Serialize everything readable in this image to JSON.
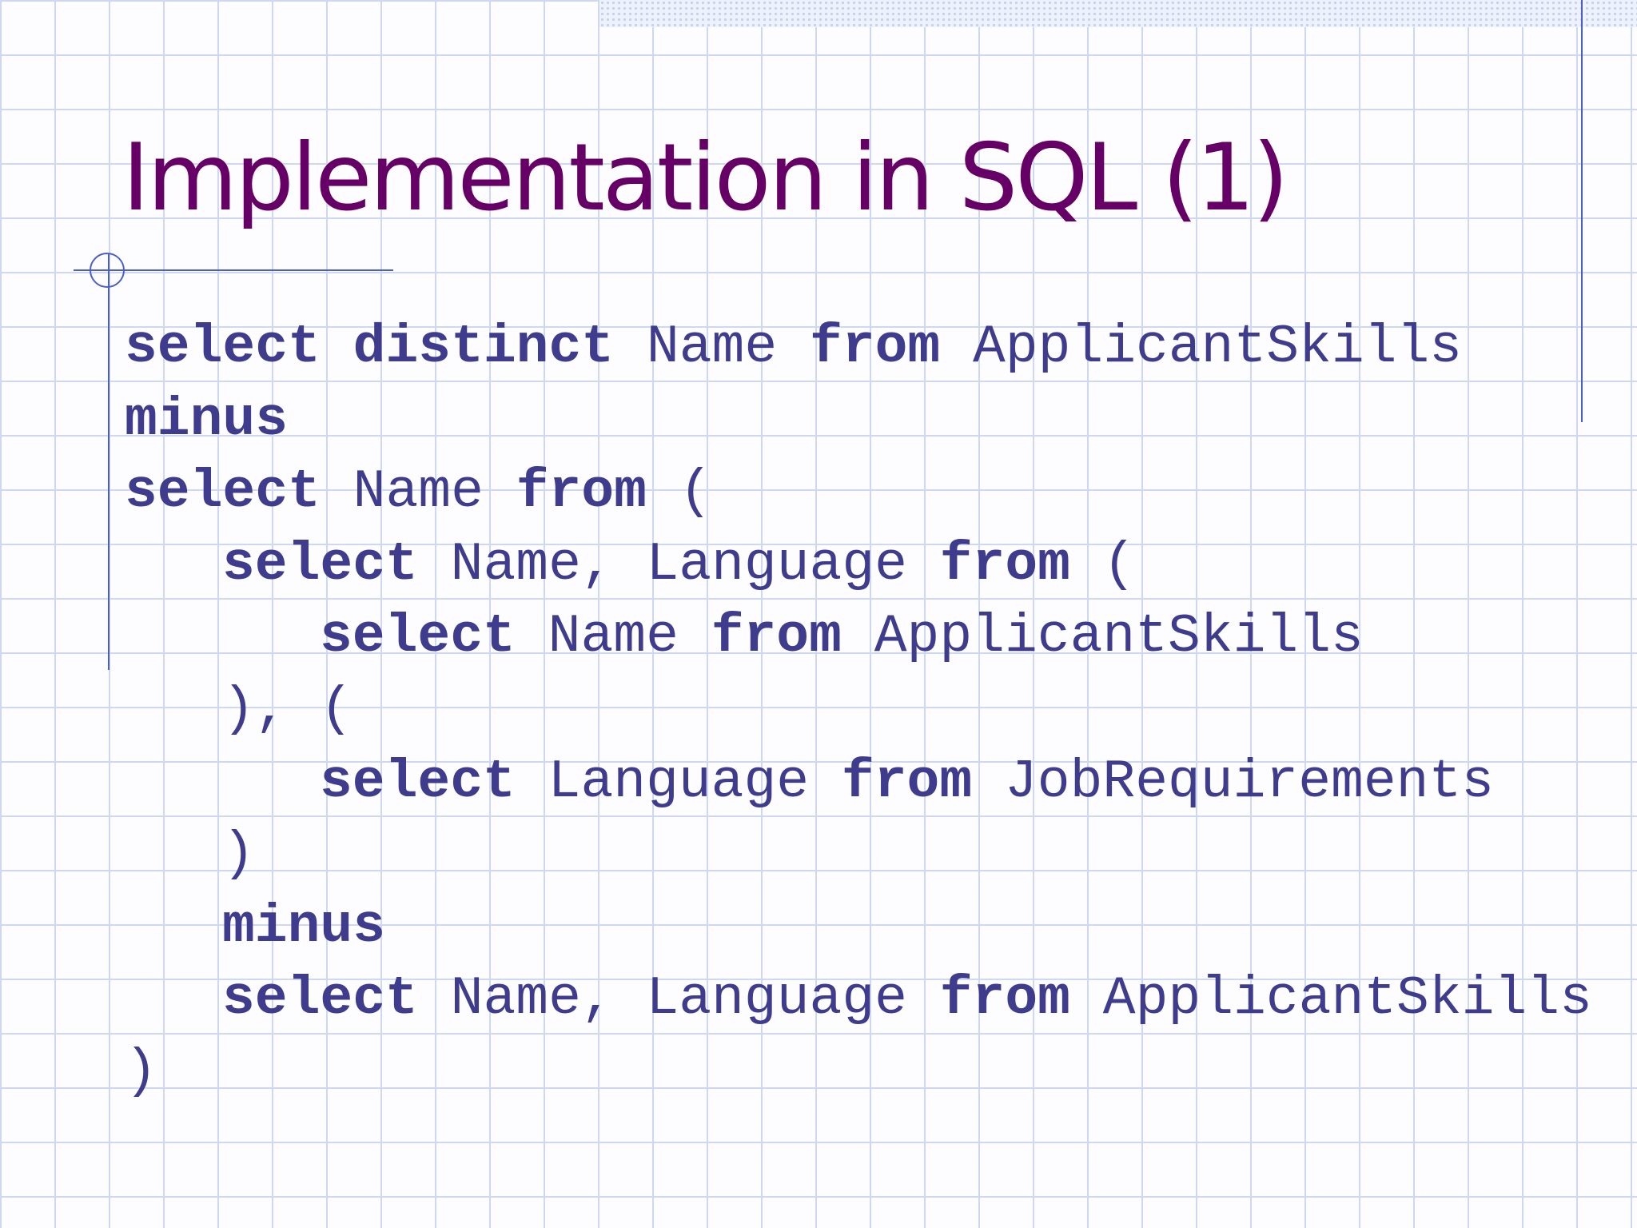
{
  "slide": {
    "title": "Implementation in SQL (1)"
  },
  "code": {
    "lines": [
      {
        "indent": 0,
        "tokens": [
          {
            "text": "select distinct",
            "kind": "keyword"
          },
          {
            "text": " Name ",
            "kind": "plain"
          },
          {
            "text": "from",
            "kind": "keyword"
          },
          {
            "text": " ApplicantSkills",
            "kind": "plain"
          }
        ]
      },
      {
        "indent": 0,
        "tokens": [
          {
            "text": "minus",
            "kind": "keyword"
          }
        ]
      },
      {
        "indent": 0,
        "tokens": [
          {
            "text": "select",
            "kind": "keyword"
          },
          {
            "text": " Name ",
            "kind": "plain"
          },
          {
            "text": "from",
            "kind": "keyword"
          },
          {
            "text": " (",
            "kind": "plain"
          }
        ]
      },
      {
        "indent": 1,
        "tokens": [
          {
            "text": "select",
            "kind": "keyword"
          },
          {
            "text": " Name, Language ",
            "kind": "plain"
          },
          {
            "text": "from",
            "kind": "keyword"
          },
          {
            "text": " (",
            "kind": "plain"
          }
        ]
      },
      {
        "indent": 2,
        "tokens": [
          {
            "text": "select",
            "kind": "keyword"
          },
          {
            "text": " Name ",
            "kind": "plain"
          },
          {
            "text": "from",
            "kind": "keyword"
          },
          {
            "text": " ApplicantSkills",
            "kind": "plain"
          }
        ]
      },
      {
        "indent": 1,
        "tokens": [
          {
            "text": "), (",
            "kind": "plain"
          }
        ]
      },
      {
        "indent": 2,
        "tokens": [
          {
            "text": "select",
            "kind": "keyword"
          },
          {
            "text": " Language ",
            "kind": "plain"
          },
          {
            "text": "from",
            "kind": "keyword"
          },
          {
            "text": " JobRequirements",
            "kind": "plain"
          }
        ]
      },
      {
        "indent": 1,
        "tokens": [
          {
            "text": ")",
            "kind": "plain"
          }
        ]
      },
      {
        "indent": 1,
        "tokens": [
          {
            "text": "minus",
            "kind": "keyword"
          }
        ]
      },
      {
        "indent": 1,
        "tokens": [
          {
            "text": "select",
            "kind": "keyword"
          },
          {
            "text": " Name, Language ",
            "kind": "plain"
          },
          {
            "text": "from",
            "kind": "keyword"
          },
          {
            "text": " ApplicantSkills",
            "kind": "plain"
          }
        ]
      },
      {
        "indent": 0,
        "tokens": [
          {
            "text": ")",
            "kind": "plain"
          }
        ]
      }
    ]
  },
  "colors": {
    "title": "#660066",
    "code": "#3f3c8e",
    "grid": "#cfd8f2",
    "accent_rule": "#4b5fc9"
  }
}
